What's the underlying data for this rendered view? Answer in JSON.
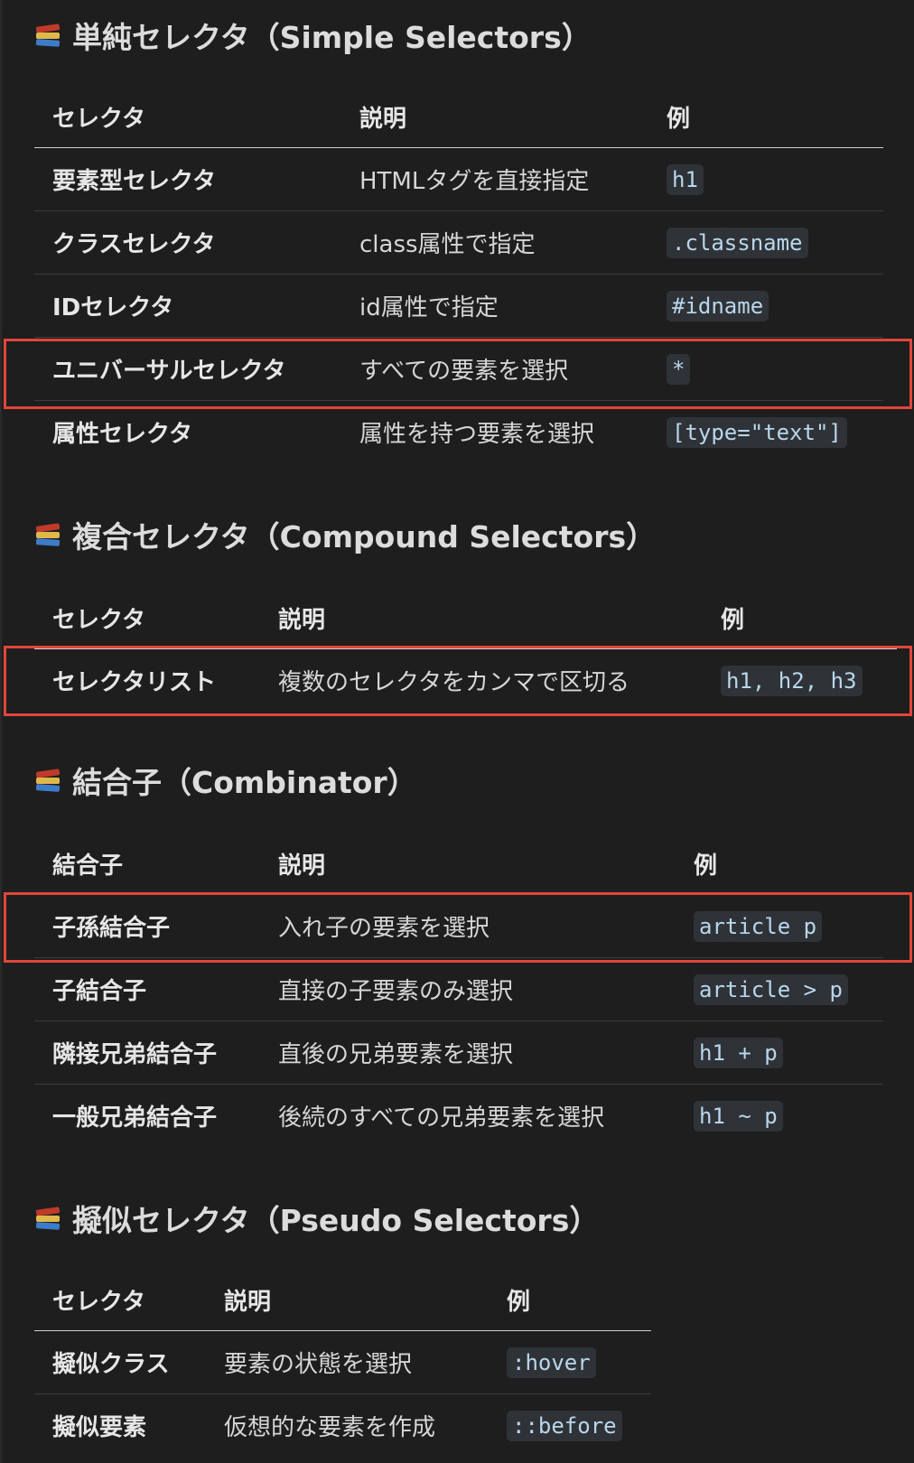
{
  "colors": {
    "background": "#1e1e1e",
    "highlight": "#e0463a",
    "code_bg": "#2f3337",
    "code_text": "#b9d7ec"
  },
  "icon": "books-icon",
  "sections": [
    {
      "title": "単純セレクタ（Simple Selectors）",
      "headers": [
        "セレクタ",
        "説明",
        "例"
      ],
      "rows": [
        [
          "要素型セレクタ",
          "HTMLタグを直接指定",
          "h1"
        ],
        [
          "クラスセレクタ",
          "class属性で指定",
          ".classname"
        ],
        [
          "IDセレクタ",
          "id属性で指定",
          "#idname"
        ],
        [
          "ユニバーサルセレクタ",
          "すべての要素を選択",
          "*"
        ],
        [
          "属性セレクタ",
          "属性を持つ要素を選択",
          "[type=\"text\"]"
        ]
      ]
    },
    {
      "title": "複合セレクタ（Compound Selectors）",
      "headers": [
        "セレクタ",
        "説明",
        "例"
      ],
      "rows": [
        [
          "セレクタリスト",
          "複数のセレクタをカンマで区切る",
          "h1, h2, h3"
        ]
      ]
    },
    {
      "title": "結合子（Combinator）",
      "headers": [
        "結合子",
        "説明",
        "例"
      ],
      "rows": [
        [
          "子孫結合子",
          "入れ子の要素を選択",
          "article p"
        ],
        [
          "子結合子",
          "直接の子要素のみ選択",
          "article > p"
        ],
        [
          "隣接兄弟結合子",
          "直後の兄弟要素を選択",
          "h1 + p"
        ],
        [
          "一般兄弟結合子",
          "後続のすべての兄弟要素を選択",
          "h1 ~ p"
        ]
      ]
    },
    {
      "title": "擬似セレクタ（Pseudo Selectors）",
      "headers": [
        "セレクタ",
        "説明",
        "例"
      ],
      "rows": [
        [
          "擬似クラス",
          "要素の状態を選択",
          ":hover"
        ],
        [
          "擬似要素",
          "仮想的な要素を作成",
          "::before"
        ]
      ]
    }
  ]
}
